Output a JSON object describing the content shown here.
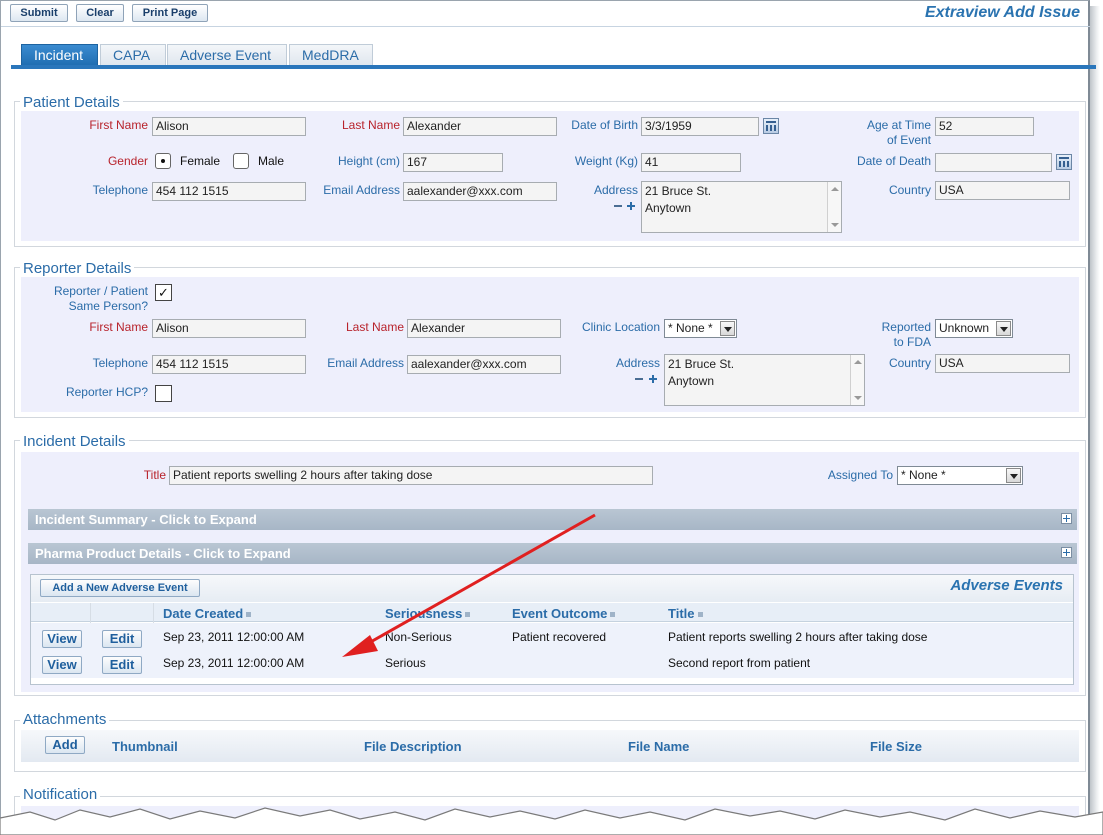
{
  "toolbar": {
    "submit": "Submit",
    "clear": "Clear",
    "print": "Print Page"
  },
  "app_title": "Extraview Add Issue",
  "tabs": [
    "Incident",
    "CAPA",
    "Adverse Event",
    "MedDRA"
  ],
  "patient": {
    "legend": "Patient Details",
    "first_name_label": "First Name",
    "first_name": "Alison",
    "last_name_label": "Last Name",
    "last_name": "Alexander",
    "dob_label": "Date of Birth",
    "dob": "3/3/1959",
    "age_label_1": "Age at Time",
    "age_label_2": "of Event",
    "age": "52",
    "gender_label": "Gender",
    "gender_female": "Female",
    "gender_male": "Male",
    "height_label": "Height (cm)",
    "height": "167",
    "weight_label": "Weight (Kg)",
    "weight": "41",
    "dod_label": "Date of Death",
    "dod": "",
    "phone_label": "Telephone",
    "phone": "454 112 1515",
    "email_label": "Email Address",
    "email": "aalexander@xxx.com",
    "address_label": "Address",
    "address_1": "21 Bruce St.",
    "address_2": "Anytown",
    "country_label": "Country",
    "country": "USA"
  },
  "reporter": {
    "legend": "Reporter Details",
    "same_label_1": "Reporter / Patient",
    "same_label_2": "Same Person?",
    "same_check": "✓",
    "first_name_label": "First Name",
    "first_name": "Alison",
    "last_name_label": "Last Name",
    "last_name": "Alexander",
    "clinic_label": "Clinic Location",
    "clinic": "* None *",
    "fda_label_1": "Reported",
    "fda_label_2": "to FDA",
    "fda": "Unknown",
    "phone_label": "Telephone",
    "phone": "454 112 1515",
    "email_label": "Email Address",
    "email": "aalexander@xxx.com",
    "address_label": "Address",
    "address_1": "21 Bruce St.",
    "address_2": "Anytown",
    "country_label": "Country",
    "country": "USA",
    "hcp_label": "Reporter HCP?"
  },
  "incident": {
    "legend": "Incident Details",
    "title_label": "Title",
    "title": "Patient reports swelling 2 hours after taking dose",
    "assigned_label": "Assigned To",
    "assigned": "* None *",
    "summary_bar": "Incident Summary - Click to Expand",
    "pharma_bar": "Pharma Product Details - Click to Expand"
  },
  "adverse_events": {
    "add_button": "Add a New Adverse Event",
    "heading": "Adverse Events",
    "columns": [
      "Date Created",
      "Seriousness",
      "Event Outcome",
      "Title"
    ],
    "view": "View",
    "edit": "Edit",
    "rows": [
      {
        "date": "Sep 23, 2011 12:00:00 AM",
        "seriousness": "Non-Serious",
        "outcome": "Patient recovered",
        "title": "Patient reports swelling 2 hours after taking dose"
      },
      {
        "date": "Sep 23, 2011 12:00:00 AM",
        "seriousness": "Serious",
        "outcome": "",
        "title": "Second report from patient"
      }
    ]
  },
  "attachments": {
    "legend": "Attachments",
    "add": "Add",
    "columns": [
      "Thumbnail",
      "File Description",
      "File Name",
      "File Size"
    ]
  },
  "notification": {
    "legend": "Notification"
  },
  "colors": {
    "accent": "#2a76bb",
    "label": "#2b6ca8",
    "required": "#b8232c",
    "band": "#eeeffc",
    "arrow": "#e02020"
  }
}
